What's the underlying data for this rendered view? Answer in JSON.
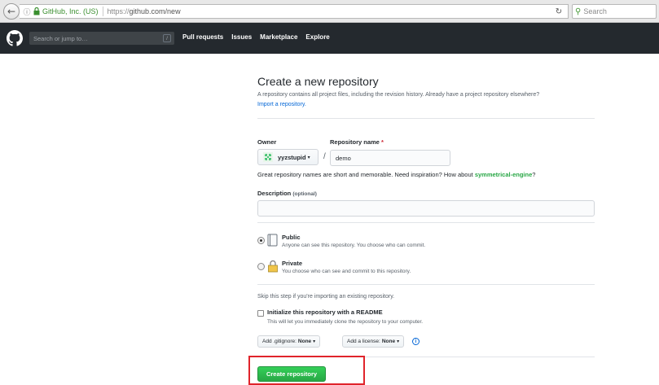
{
  "browser": {
    "site_identity": "GitHub, Inc. (US)",
    "url_scheme": "https://",
    "url_rest": "github.com/new",
    "search_placeholder": "Search"
  },
  "header": {
    "search_placeholder": "Search or jump to…",
    "slash_key": "/",
    "nav": [
      "Pull requests",
      "Issues",
      "Marketplace",
      "Explore"
    ]
  },
  "page": {
    "title": "Create a new repository",
    "description": "A repository contains all project files, including the revision history. Already have a project repository elsewhere?",
    "import_link": "Import a repository."
  },
  "form": {
    "owner_label": "Owner",
    "owner_value": "yyzstupid",
    "repo_name_label": "Repository name",
    "required_mark": "*",
    "repo_name_value": "demo",
    "separator": "/",
    "name_hint_prefix": "Great repository names are short and memorable. Need inspiration? How about ",
    "name_hint_suggestion": "symmetrical-engine",
    "name_hint_suffix": "?",
    "description_label": "Description",
    "description_optional": "(optional)",
    "description_value": "",
    "visibility": [
      {
        "title": "Public",
        "note": "Anyone can see this repository. You choose who can commit.",
        "checked": true
      },
      {
        "title": "Private",
        "note": "You choose who can see and commit to this repository.",
        "checked": false
      }
    ],
    "skip_note": "Skip this step if you're importing an existing repository.",
    "readme_title": "Initialize this repository with a README",
    "readme_note": "This will let you immediately clone the repository to your computer.",
    "gitignore_prefix": "Add .gitignore:",
    "gitignore_value": "None",
    "license_prefix": "Add a license:",
    "license_value": "None",
    "info_glyph": "i",
    "create_button": "Create repository"
  },
  "colors": {
    "header_bg": "#24292e",
    "link": "#0366d6",
    "primary_green": "#28a745",
    "highlight": "#e0242b"
  }
}
